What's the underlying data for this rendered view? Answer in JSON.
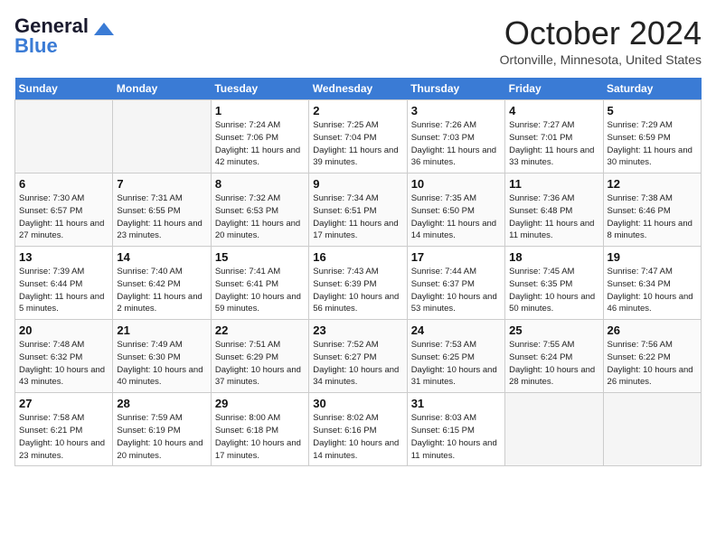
{
  "header": {
    "logo_line1": "General",
    "logo_line2": "Blue",
    "month": "October 2024",
    "location": "Ortonville, Minnesota, United States"
  },
  "weekdays": [
    "Sunday",
    "Monday",
    "Tuesday",
    "Wednesday",
    "Thursday",
    "Friday",
    "Saturday"
  ],
  "weeks": [
    [
      {
        "day": "",
        "info": ""
      },
      {
        "day": "",
        "info": ""
      },
      {
        "day": "1",
        "info": "Sunrise: 7:24 AM\nSunset: 7:06 PM\nDaylight: 11 hours and 42 minutes."
      },
      {
        "day": "2",
        "info": "Sunrise: 7:25 AM\nSunset: 7:04 PM\nDaylight: 11 hours and 39 minutes."
      },
      {
        "day": "3",
        "info": "Sunrise: 7:26 AM\nSunset: 7:03 PM\nDaylight: 11 hours and 36 minutes."
      },
      {
        "day": "4",
        "info": "Sunrise: 7:27 AM\nSunset: 7:01 PM\nDaylight: 11 hours and 33 minutes."
      },
      {
        "day": "5",
        "info": "Sunrise: 7:29 AM\nSunset: 6:59 PM\nDaylight: 11 hours and 30 minutes."
      }
    ],
    [
      {
        "day": "6",
        "info": "Sunrise: 7:30 AM\nSunset: 6:57 PM\nDaylight: 11 hours and 27 minutes."
      },
      {
        "day": "7",
        "info": "Sunrise: 7:31 AM\nSunset: 6:55 PM\nDaylight: 11 hours and 23 minutes."
      },
      {
        "day": "8",
        "info": "Sunrise: 7:32 AM\nSunset: 6:53 PM\nDaylight: 11 hours and 20 minutes."
      },
      {
        "day": "9",
        "info": "Sunrise: 7:34 AM\nSunset: 6:51 PM\nDaylight: 11 hours and 17 minutes."
      },
      {
        "day": "10",
        "info": "Sunrise: 7:35 AM\nSunset: 6:50 PM\nDaylight: 11 hours and 14 minutes."
      },
      {
        "day": "11",
        "info": "Sunrise: 7:36 AM\nSunset: 6:48 PM\nDaylight: 11 hours and 11 minutes."
      },
      {
        "day": "12",
        "info": "Sunrise: 7:38 AM\nSunset: 6:46 PM\nDaylight: 11 hours and 8 minutes."
      }
    ],
    [
      {
        "day": "13",
        "info": "Sunrise: 7:39 AM\nSunset: 6:44 PM\nDaylight: 11 hours and 5 minutes."
      },
      {
        "day": "14",
        "info": "Sunrise: 7:40 AM\nSunset: 6:42 PM\nDaylight: 11 hours and 2 minutes."
      },
      {
        "day": "15",
        "info": "Sunrise: 7:41 AM\nSunset: 6:41 PM\nDaylight: 10 hours and 59 minutes."
      },
      {
        "day": "16",
        "info": "Sunrise: 7:43 AM\nSunset: 6:39 PM\nDaylight: 10 hours and 56 minutes."
      },
      {
        "day": "17",
        "info": "Sunrise: 7:44 AM\nSunset: 6:37 PM\nDaylight: 10 hours and 53 minutes."
      },
      {
        "day": "18",
        "info": "Sunrise: 7:45 AM\nSunset: 6:35 PM\nDaylight: 10 hours and 50 minutes."
      },
      {
        "day": "19",
        "info": "Sunrise: 7:47 AM\nSunset: 6:34 PM\nDaylight: 10 hours and 46 minutes."
      }
    ],
    [
      {
        "day": "20",
        "info": "Sunrise: 7:48 AM\nSunset: 6:32 PM\nDaylight: 10 hours and 43 minutes."
      },
      {
        "day": "21",
        "info": "Sunrise: 7:49 AM\nSunset: 6:30 PM\nDaylight: 10 hours and 40 minutes."
      },
      {
        "day": "22",
        "info": "Sunrise: 7:51 AM\nSunset: 6:29 PM\nDaylight: 10 hours and 37 minutes."
      },
      {
        "day": "23",
        "info": "Sunrise: 7:52 AM\nSunset: 6:27 PM\nDaylight: 10 hours and 34 minutes."
      },
      {
        "day": "24",
        "info": "Sunrise: 7:53 AM\nSunset: 6:25 PM\nDaylight: 10 hours and 31 minutes."
      },
      {
        "day": "25",
        "info": "Sunrise: 7:55 AM\nSunset: 6:24 PM\nDaylight: 10 hours and 28 minutes."
      },
      {
        "day": "26",
        "info": "Sunrise: 7:56 AM\nSunset: 6:22 PM\nDaylight: 10 hours and 26 minutes."
      }
    ],
    [
      {
        "day": "27",
        "info": "Sunrise: 7:58 AM\nSunset: 6:21 PM\nDaylight: 10 hours and 23 minutes."
      },
      {
        "day": "28",
        "info": "Sunrise: 7:59 AM\nSunset: 6:19 PM\nDaylight: 10 hours and 20 minutes."
      },
      {
        "day": "29",
        "info": "Sunrise: 8:00 AM\nSunset: 6:18 PM\nDaylight: 10 hours and 17 minutes."
      },
      {
        "day": "30",
        "info": "Sunrise: 8:02 AM\nSunset: 6:16 PM\nDaylight: 10 hours and 14 minutes."
      },
      {
        "day": "31",
        "info": "Sunrise: 8:03 AM\nSunset: 6:15 PM\nDaylight: 10 hours and 11 minutes."
      },
      {
        "day": "",
        "info": ""
      },
      {
        "day": "",
        "info": ""
      }
    ]
  ]
}
